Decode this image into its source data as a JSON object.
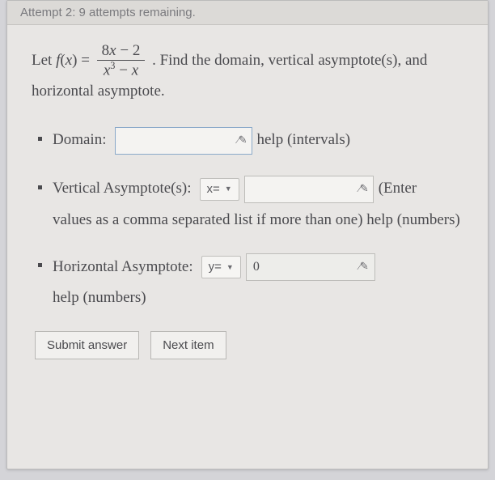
{
  "attempt_bar": "Attempt 2: 9 attempts remaining.",
  "problem": {
    "let_prefix": "Let ",
    "func": "f(x) = ",
    "numerator": "8x − 2",
    "denominator_html": "x³ − x",
    "suffix": ". Find the domain, vertical asymptote(s), and horizontal asymptote."
  },
  "domain": {
    "label": "Domain:",
    "value": "",
    "help": "help (intervals)"
  },
  "vertical": {
    "label": "Vertical Asymptote(s):",
    "dropdown": "x=",
    "value": "",
    "enter": "(Enter",
    "note": "values as a comma separated list if more than one) help (numbers)"
  },
  "horizontal": {
    "label": "Horizontal Asymptote:",
    "dropdown": "y=",
    "value": "0",
    "help": "help (numbers)"
  },
  "buttons": {
    "submit": "Submit answer",
    "next": "Next item"
  },
  "glyphs": {
    "handle": "⁄✎"
  }
}
